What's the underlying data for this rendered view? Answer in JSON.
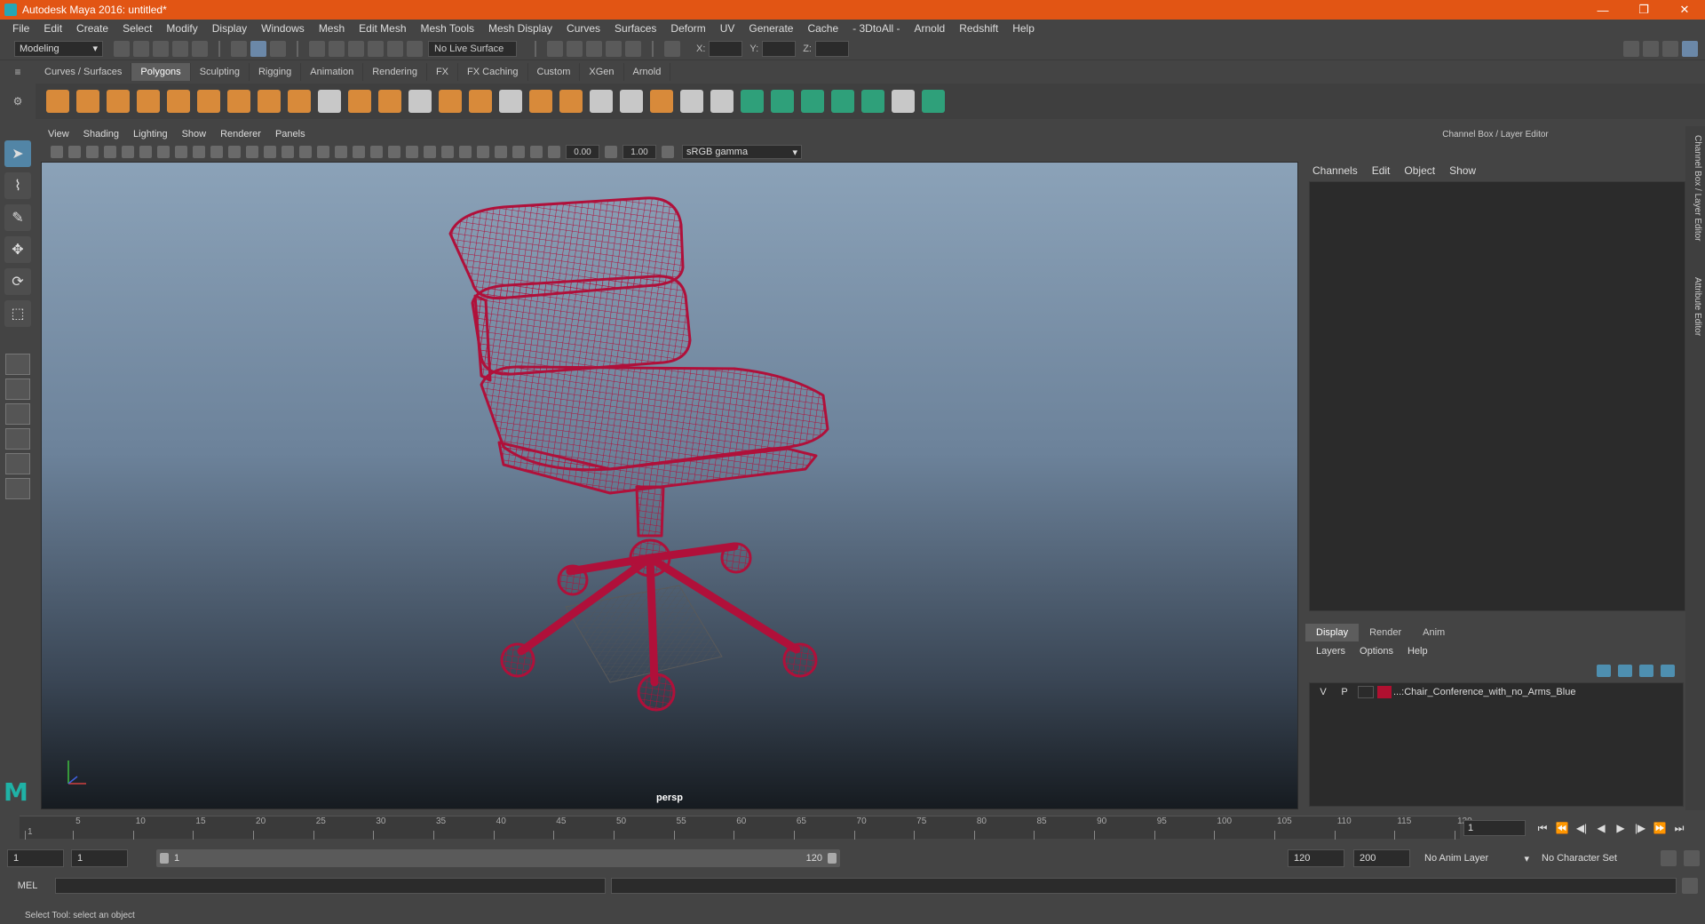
{
  "window": {
    "title": "Autodesk Maya 2016: untitled*",
    "min_glyph": "—",
    "max_glyph": "❐",
    "close_glyph": "✕"
  },
  "menubar": [
    "File",
    "Edit",
    "Create",
    "Select",
    "Modify",
    "Display",
    "Windows",
    "Mesh",
    "Edit Mesh",
    "Mesh Tools",
    "Mesh Display",
    "Curves",
    "Surfaces",
    "Deform",
    "UV",
    "Generate",
    "Cache",
    "- 3DtoAll -",
    "Arnold",
    "Redshift",
    "Help"
  ],
  "statusline": {
    "menu_set": "Modeling",
    "live_surface": "No Live Surface",
    "x_label": "X:",
    "y_label": "Y:",
    "z_label": "Z:"
  },
  "shelf": {
    "tabs": [
      "Curves / Surfaces",
      "Polygons",
      "Sculpting",
      "Rigging",
      "Animation",
      "Rendering",
      "FX",
      "FX Caching",
      "Custom",
      "XGen",
      "Arnold"
    ],
    "active_tab": "Polygons"
  },
  "viewport": {
    "menus": [
      "View",
      "Shading",
      "Lighting",
      "Show",
      "Renderer",
      "Panels"
    ],
    "exposure": "0.00",
    "gamma": "1.00",
    "color_space": "sRGB gamma",
    "camera": "persp",
    "wire_color": "#b0103a"
  },
  "channel_box": {
    "title": "Channel Box / Layer Editor",
    "menus": [
      "Channels",
      "Edit",
      "Object",
      "Show"
    ]
  },
  "layer_editor": {
    "tabs": [
      "Display",
      "Render",
      "Anim"
    ],
    "active_tab": "Display",
    "menus": [
      "Layers",
      "Options",
      "Help"
    ],
    "layers": [
      {
        "v": "V",
        "p": "P",
        "name": "...:Chair_Conference_with_no_Arms_Blue",
        "color": "#b01030"
      }
    ]
  },
  "side_tabs": [
    "Channel Box / Layer Editor",
    "Attribute Editor"
  ],
  "timeslider": {
    "ticks": [
      "1",
      "5",
      "10",
      "15",
      "20",
      "25",
      "30",
      "35",
      "40",
      "45",
      "50",
      "55",
      "60",
      "65",
      "70",
      "75",
      "80",
      "85",
      "90",
      "95",
      "100",
      "105",
      "110",
      "115",
      "120"
    ],
    "current_frame": "1"
  },
  "range": {
    "start": "1",
    "playback_start": "1",
    "range_start_label": "1",
    "range_end_label": "120",
    "playback_end": "120",
    "end": "200",
    "anim_layer": "No Anim Layer",
    "character_set": "No Character Set"
  },
  "commandline": {
    "label": "MEL"
  },
  "helpline": {
    "text": "Select Tool: select an object"
  }
}
